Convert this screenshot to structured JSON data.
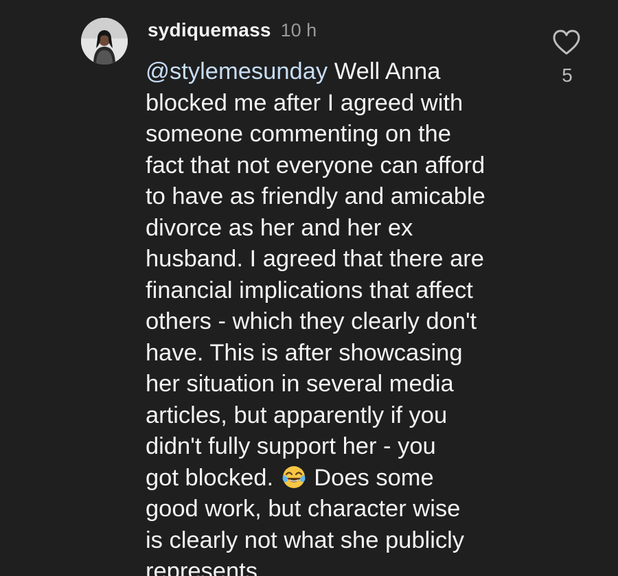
{
  "comment": {
    "username": "sydiquemass",
    "timestamp": "10 h",
    "mention": "@stylemesunday",
    "lines": [
      " Well Anna",
      "blocked me after I agreed with",
      "someone commenting on the",
      "fact that not everyone can afford",
      "to have as friendly and amicable",
      "divorce as her and her ex",
      "husband. I agreed that there are",
      "financial implications that affect",
      "others - which they clearly don't",
      "have. This is after showcasing",
      "her situation in several media",
      "articles, but apparently if you",
      "didn't fully support her - you"
    ],
    "emoji_line_before": "got blocked. ",
    "emoji_name": "tears-of-joy-icon",
    "emoji_line_after": " Does some",
    "tail_lines": [
      "good work, but character wise",
      "is clearly not what she publicly",
      "represents."
    ],
    "like_icon": "heart-outline-icon",
    "like_count": "5"
  },
  "colors": {
    "background": "#1f1f1f",
    "text": "#f4f4f4",
    "mention": "#c7ddf5",
    "muted": "#9a9a9a"
  }
}
